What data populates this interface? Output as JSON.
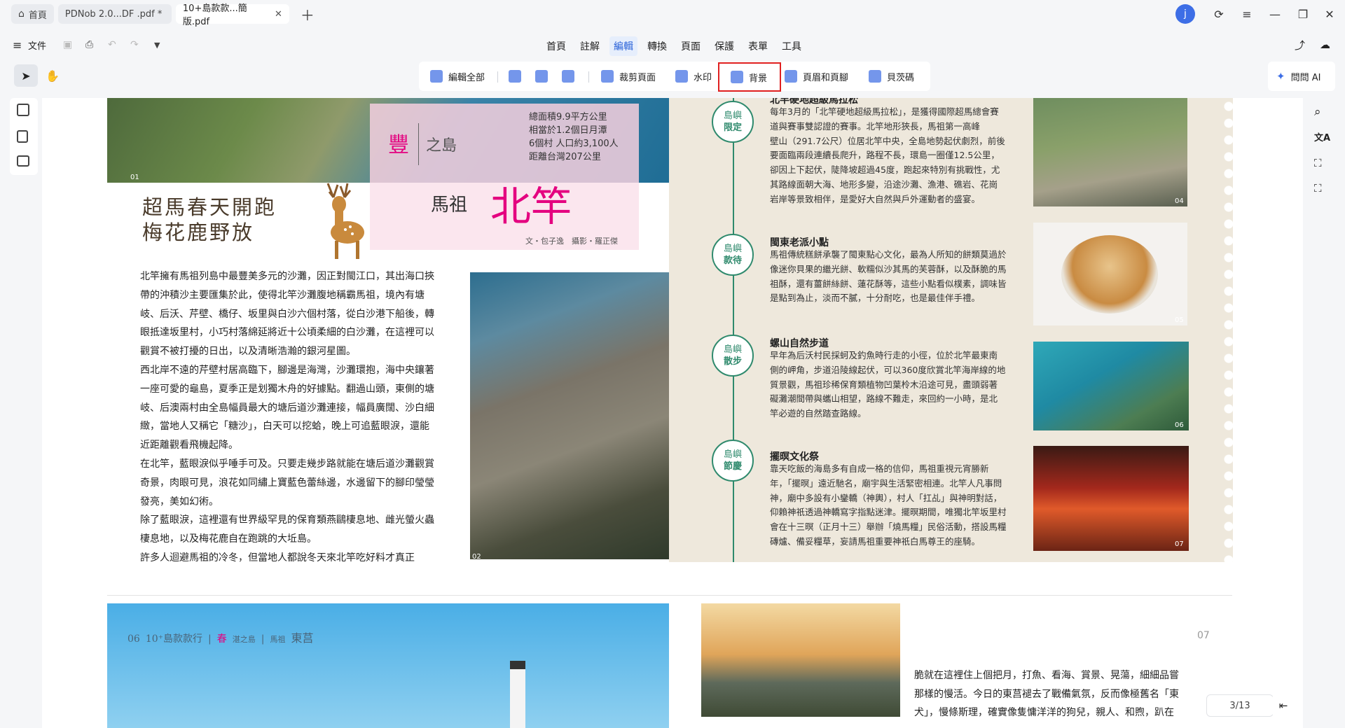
{
  "tabs": [
    {
      "label": "首頁"
    },
    {
      "label": "PDNob 2.0...DF .pdf *"
    },
    {
      "label": "10+島款款...簡版.pdf"
    }
  ],
  "user": {
    "avatar_letter": "j"
  },
  "menubar": {
    "file": "文件",
    "items": [
      "首頁",
      "註解",
      "編輯",
      "轉換",
      "頁面",
      "保護",
      "表單",
      "工具"
    ],
    "active_index": 2
  },
  "toolbar": {
    "edit_all": "編輯全部",
    "crop": "裁剪頁面",
    "watermark": "水印",
    "background": "背景",
    "header_footer": "頁眉和頁腳",
    "page_number": "貝茨碼",
    "ask_ai": "問問 AI"
  },
  "page": {
    "indicator": "3/13"
  },
  "colors": {
    "accent": "#2b63d9",
    "highlight_box": "#e02020",
    "green": "#2f8a6d",
    "pink": "#e4007f"
  },
  "doc": {
    "left_page": {
      "stats": {
        "lines": [
          "總面積9.9平方公里",
          "相當於1.2個日月潭",
          "6個村 人口約3,100人",
          "距離台灣207公里"
        ]
      },
      "island_title": "豐",
      "island_sub": "之島",
      "matsu": "馬祖",
      "beigan": "北竿",
      "credit": "文・包子逸　攝影・羅正傑",
      "headline_1": "超馬春天開跑",
      "headline_2": "梅花鹿野放",
      "photo_num_1": "01",
      "photo_num_2": "02",
      "paragraphs": [
        "北竿擁有馬祖列島中最豐美多元的沙灘，因正對閩江口，其出海口挾",
        "帶的沖積沙主要匯集於此，使得北竿沙灘腹地稱霸馬祖，境內有塘",
        "岐、后沃、芹壁、橋仔、坂里與白沙六個村落，從白沙港下船後，轉",
        "眼抵達坂里村，小巧村落綿延將近十公頃柔細的白沙灘，在這裡可以",
        "觀賞不被打擾的日出，以及清晰浩瀚的銀河星圖。",
        "西北岸不遠的芹壁村居高臨下，腳邊是海灣，沙灘環抱，海中央鑲著",
        "一座可愛的龜島，夏季正是划獨木舟的好據點。翻過山頭，東側的塘",
        "岐、后澳兩村由全島幅員最大的塘后道沙灘連接，幅員廣闊、沙白細",
        "緻，當地人又稱它「糖沙」，白天可以挖蛤，晚上可追藍眼淚，還能",
        "近距離觀看飛機起降。",
        "在北竿，藍眼淚似乎唾手可及。只要走幾步路就能在塘后道沙灘觀賞",
        "奇景，肉眼可見，浪花如同繡上寶藍色蕾絲邊，水邊留下的腳印瑩瑩",
        "發亮，美如幻術。",
        "除了藍眼淚，這裡還有世界級罕見的保育類燕鷗棲息地、雌光螢火蟲",
        "棲息地，以及梅花鹿自在跑跳的大坵島。",
        "許多人迴避馬祖的冷冬，但當地人都說冬天來北竿吃好料才真正"
      ]
    },
    "right_page": {
      "sections": [
        {
          "badge_top": "島嶼",
          "badge_bottom": "限定",
          "title": "北竿硬地超級馬拉松",
          "lines": [
            "每年3月的「北竿硬地超級馬拉松」，是獲得國際超馬總會賽",
            "道與賽事雙認證的賽事。北竿地形狹長，馬祖第一高峰",
            "壁山（291.7公尺）位居北竿中央，全島地勢起伏劇烈，前後",
            "要面臨兩段連續長爬升，路程不長，環島一圈僅12.5公里，",
            "卻因上下起伏，陡降坡超過45度，跑起來特別有挑戰性，尤",
            "其路線面朝大海、地形多變，沿途沙灘、漁港、礁岩、花崗",
            "岩岸等景致相伴，是愛好大自然與戶外運動者的盛宴。"
          ],
          "num": "04"
        },
        {
          "badge_top": "島嶼",
          "badge_bottom": "款待",
          "title": "閩東老派小點",
          "lines": [
            "馬祖傳統糕餅承襲了閩東點心文化，最為人所知的餅類莫過於",
            "像迷你貝果的繼光餅、軟糯似沙其馬的芙蓉酥，以及酥脆的馬",
            "祖酥，還有薑餅絲餅、蓮花酥等，這些小點看似樸素，調味皆",
            "是點到為止，淡而不膩，十分耐吃，也是最佳伴手禮。"
          ],
          "num": "05"
        },
        {
          "badge_top": "島嶼",
          "badge_bottom": "散步",
          "title": "螺山自然步道",
          "lines": [
            "早年為后沃村民採蚵及釣魚時行走的小徑，位於北竿最東南",
            "側的岬角，步道沿陵線起伏，可以360度欣賞北竿海岸線的地",
            "質景觀，馬祖珍稀保育類植物凹葉柃木沿途可見，盡頭弱著",
            "礙灘潮間帶與蠵山相望，路線不難走，來回約一小時，是北",
            "竿必遊的自然踏查路線。"
          ],
          "num": "06"
        },
        {
          "badge_top": "島嶼",
          "badge_bottom": "節慶",
          "title": "擺暝文化祭",
          "lines": [
            "靠天吃飯的海島多有自成一格的信仰，馬祖重視元宵勝新",
            "年，「擺暝」遠近馳名，廟宇與生活緊密相連。北竿人凡事問",
            "神，廟中多設有小鑾轎（神輿），村人「扛乩」與神明對話，",
            "仰賴神祇透過神轎寫字指點迷津。擺暝期間，唯獨北竿坂里村",
            "會在十三暝（正月十三）舉辦「燒馬糧」民俗活動，搭設馬糧",
            "磚爐、備妥糧草，妄請馬祖重要神祇白馬尊王的座騎。"
          ],
          "num": "07"
        }
      ]
    },
    "lower_left": {
      "page_no": "06",
      "series": "10⁺島款款行",
      "tag": "春",
      "tag_sub": "湛之島",
      "matsu": "馬祖",
      "dongyin": "東莒"
    },
    "lower_right": {
      "page_no": "07",
      "lines": [
        "脆就在這裡住上個把月，打魚、看海、賞景、晃蕩，細細品嘗",
        "那樣的慢活。今日的東莒褪去了戰備氣氛，反而像極舊名「東",
        "犬」，慢條斯理，確實像隻慵洋洋的狗兒，親人、和煦，趴在"
      ]
    }
  }
}
